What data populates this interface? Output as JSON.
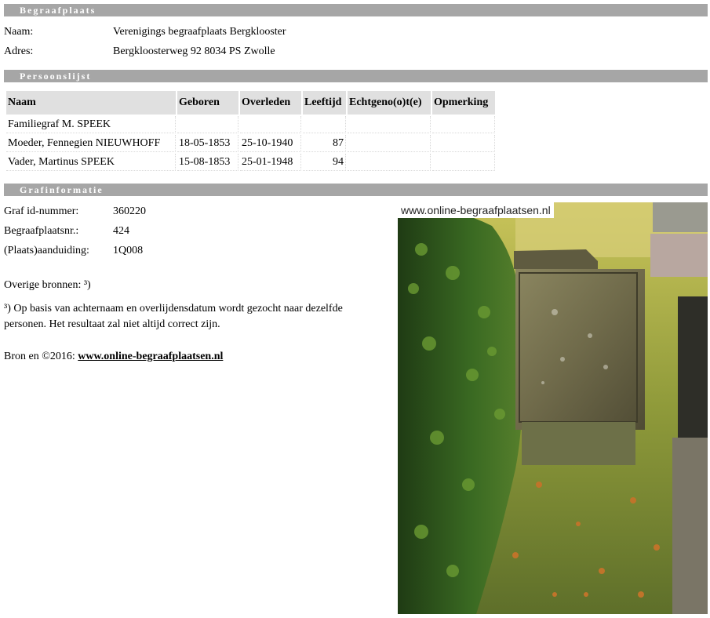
{
  "sections": {
    "begraafplaats": "Begraafplaats",
    "persoonslijst": "Persoonslijst",
    "grafinformatie": "Grafinformatie"
  },
  "begraafplaats": {
    "naam_label": "Naam:",
    "naam_value": "Verenigings begraafplaats Bergklooster",
    "adres_label": "Adres:",
    "adres_value": "Bergkloosterweg 92 8034 PS Zwolle"
  },
  "persons": {
    "headers": [
      "Naam",
      "Geboren",
      "Overleden",
      "Leeftijd",
      "Echtgeno(o)t(e)",
      "Opmerking"
    ],
    "rows": [
      [
        "Familiegraf M. SPEEK",
        "",
        "",
        "",
        "",
        ""
      ],
      [
        "Moeder, Fennegien NIEUWHOFF",
        "18-05-1853",
        "25-10-1940",
        "87",
        "",
        ""
      ],
      [
        "Vader, Martinus SPEEK",
        "15-08-1853",
        "25-01-1948",
        "94",
        "",
        ""
      ]
    ]
  },
  "grafinfo": {
    "id_label": "Graf id-nummer:",
    "id_value": "360220",
    "nr_label": "Begraafplaatsnr.:",
    "nr_value": "424",
    "aand_label": "(Plaats)aanduiding:",
    "aand_value": "1Q008",
    "overige": "Overige bronnen: ³)",
    "footnote": "³) Op basis van achternaam en overlijdensdatum wordt gezocht naar dezelfde personen. Het resultaat zal niet altijd correct zijn.",
    "bron_prefix": "Bron en ©2016: ",
    "bron_link": "www.online-begraafplaatsen.nl"
  },
  "photo": {
    "watermark": "www.online-begraafplaatsen.nl"
  }
}
